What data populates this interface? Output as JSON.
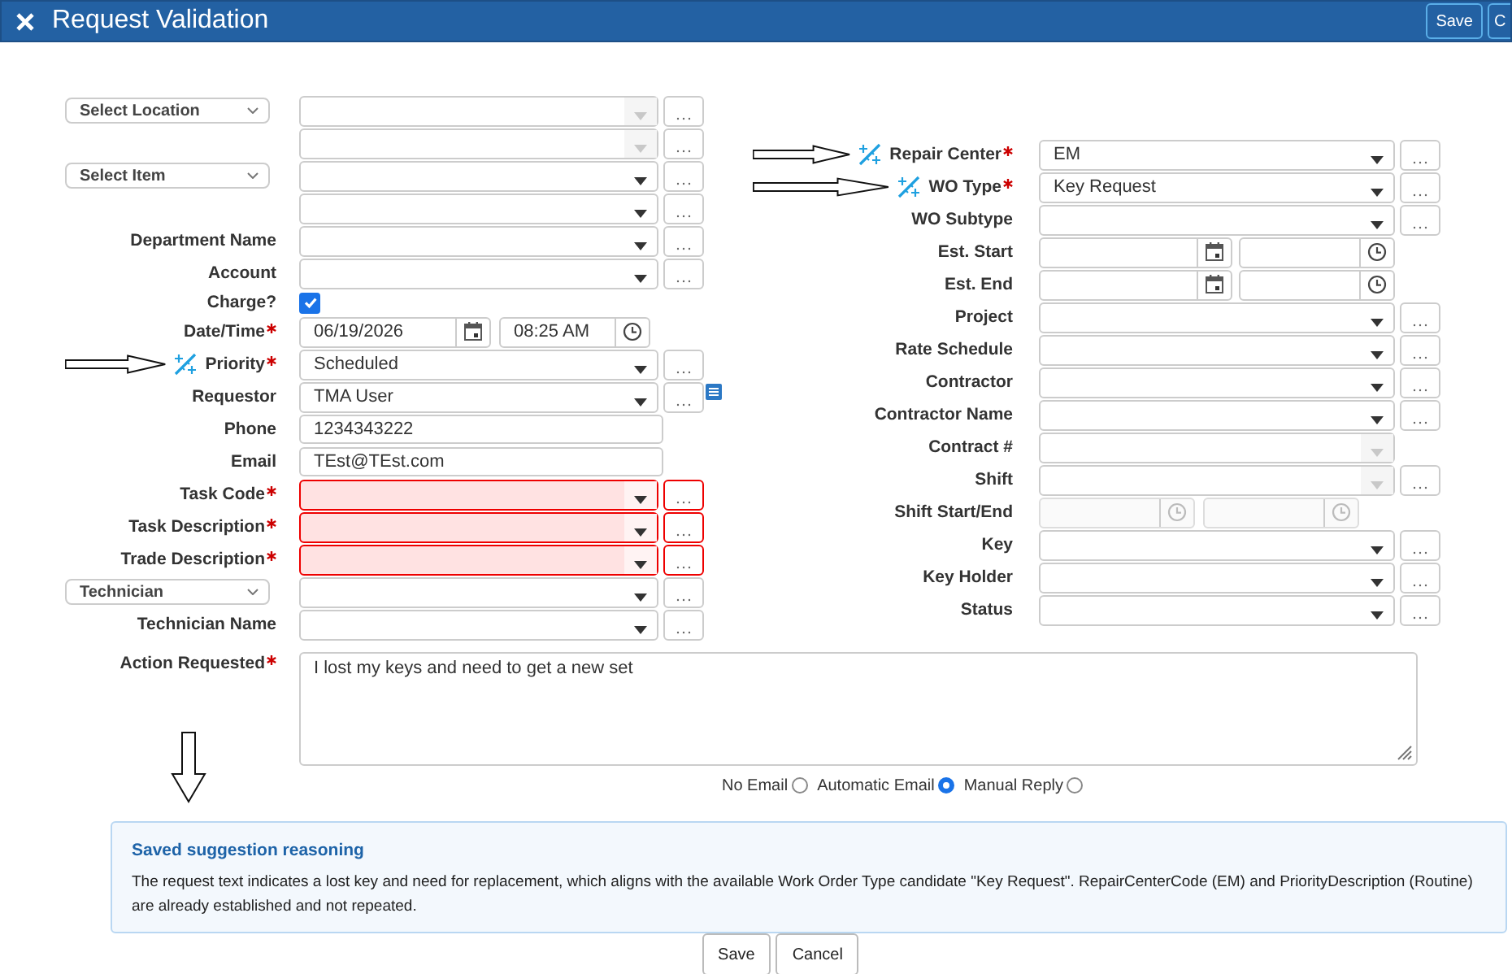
{
  "window": {
    "title": "Request Validation",
    "buttons": [
      "Save",
      "C"
    ]
  },
  "left_fields": [
    {
      "selector": "Select Location",
      "kind": "combo",
      "required": false,
      "suggested": false,
      "disabled": true,
      "error": false
    },
    {
      "kind": "combo",
      "required": false,
      "suggested": false,
      "disabled": true,
      "error": false
    },
    {
      "selector": "Select Item",
      "kind": "combo",
      "required": false,
      "suggested": false,
      "disabled": false,
      "error": false
    },
    {
      "kind": "combo",
      "required": false,
      "suggested": false,
      "disabled": false,
      "error": false
    },
    {
      "label": "Department Name",
      "kind": "combo",
      "required": false,
      "suggested": false,
      "disabled": false,
      "error": false
    },
    {
      "label": "Account",
      "kind": "combo",
      "required": false,
      "suggested": false,
      "disabled": false,
      "error": false
    },
    {
      "label": "Charge?",
      "kind": "checkbox",
      "checked": true,
      "required": false,
      "suggested": false,
      "disabled": false,
      "error": false
    },
    {
      "label": "Date/Time",
      "kind": "datetime",
      "date": "06/19/2026",
      "time": "08:25 AM",
      "required": true,
      "suggested": false,
      "disabled": false,
      "error": false
    },
    {
      "label": "Priority",
      "kind": "combo",
      "value": "Scheduled",
      "required": true,
      "suggested": true,
      "disabled": false,
      "error": false
    },
    {
      "label": "Requestor",
      "kind": "combo_list",
      "value": "TMA User",
      "required": false,
      "suggested": false,
      "disabled": false,
      "error": false
    },
    {
      "label": "Phone",
      "kind": "text",
      "value": "1234343222",
      "required": false,
      "suggested": false,
      "disabled": false,
      "error": false
    },
    {
      "label": "Email",
      "kind": "text",
      "value": "TEst@TEst.com",
      "required": false,
      "suggested": false,
      "disabled": false,
      "error": false
    },
    {
      "label": "Task Code",
      "kind": "combo",
      "required": true,
      "suggested": false,
      "disabled": false,
      "error": true
    },
    {
      "label": "Task Description",
      "kind": "combo",
      "required": true,
      "suggested": false,
      "disabled": false,
      "error": true
    },
    {
      "label": "Trade Description",
      "kind": "combo",
      "required": true,
      "suggested": false,
      "disabled": false,
      "error": true
    },
    {
      "selector": "Technician",
      "kind": "combo",
      "required": false,
      "suggested": false,
      "disabled": false,
      "error": false
    },
    {
      "label": "Technician Name",
      "kind": "combo",
      "required": false,
      "suggested": false,
      "disabled": false,
      "error": false
    }
  ],
  "right_fields": [
    {
      "label": "Repair Center",
      "kind": "combo",
      "value": "EM",
      "required": true,
      "suggested": true,
      "disabled": false
    },
    {
      "label": "WO Type",
      "kind": "combo",
      "value": "Key Request",
      "required": true,
      "suggested": true,
      "disabled": false
    },
    {
      "label": "WO Subtype",
      "kind": "combo",
      "required": false,
      "suggested": false,
      "disabled": false
    },
    {
      "label": "Est. Start",
      "kind": "datetime",
      "required": false,
      "suggested": false,
      "disabled": false
    },
    {
      "label": "Est. End",
      "kind": "datetime",
      "required": false,
      "suggested": false,
      "disabled": false
    },
    {
      "label": "Project",
      "kind": "combo",
      "required": false,
      "suggested": false,
      "disabled": false
    },
    {
      "label": "Rate Schedule",
      "kind": "combo",
      "required": false,
      "suggested": false,
      "disabled": false
    },
    {
      "label": "Contractor",
      "kind": "combo",
      "required": false,
      "suggested": false,
      "disabled": false
    },
    {
      "label": "Contractor Name",
      "kind": "combo",
      "required": false,
      "suggested": false,
      "disabled": false
    },
    {
      "label": "Contract #",
      "kind": "dropdown",
      "required": false,
      "suggested": false,
      "disabled": true
    },
    {
      "label": "Shift",
      "kind": "combo",
      "required": false,
      "suggested": false,
      "disabled": true
    },
    {
      "label": "Shift Start/End",
      "kind": "timerange",
      "required": false,
      "suggested": false,
      "disabled": true
    },
    {
      "label": "Key",
      "kind": "combo",
      "required": false,
      "suggested": false,
      "disabled": false
    },
    {
      "label": "Key Holder",
      "kind": "combo",
      "required": false,
      "suggested": false,
      "disabled": false
    },
    {
      "label": "Status",
      "kind": "combo",
      "required": false,
      "suggested": false,
      "disabled": false
    }
  ],
  "action_requested": {
    "label": "Action Requested",
    "required": true,
    "value": "I lost my keys and need to get a new set"
  },
  "email_options": [
    {
      "label": "No Email",
      "selected": false
    },
    {
      "label": "Automatic Email",
      "selected": true
    },
    {
      "label": "Manual Reply",
      "selected": false
    }
  ],
  "reasoning": {
    "title": "Saved suggestion reasoning",
    "text": "The request text indicates a lost key and need for replacement, which aligns with the available Work Order Type candidate \"Key Request\". RepairCenterCode (EM) and PriorityDescription (Routine) are already established and not repeated."
  },
  "footer_buttons": [
    "Save",
    "Cancel"
  ]
}
